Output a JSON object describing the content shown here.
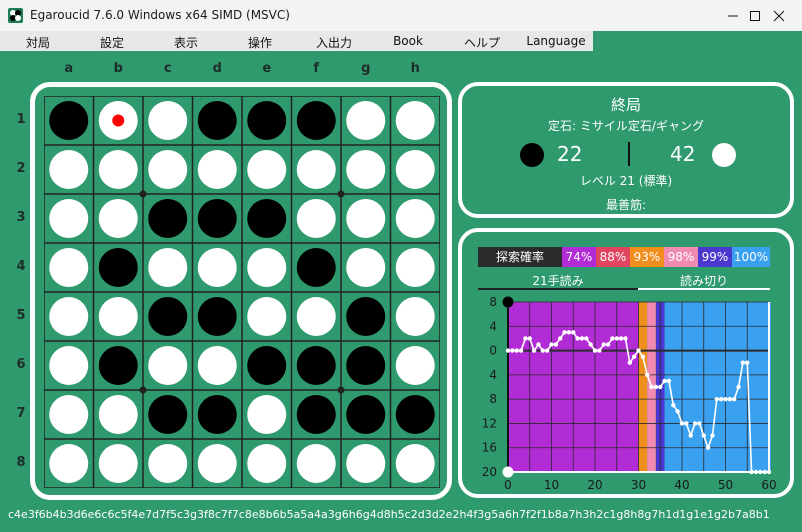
{
  "window": {
    "title": "Egaroucid 7.6.0 Windows x64 SIMD (MSVC)",
    "icon": "othello-app-icon",
    "controls": [
      "minimize-icon",
      "maximize-icon",
      "close-icon"
    ]
  },
  "menu": [
    "対局",
    "設定",
    "表示",
    "操作",
    "入出力",
    "Book",
    "ヘルプ",
    "Language"
  ],
  "board": {
    "columns": [
      "a",
      "b",
      "c",
      "d",
      "e",
      "f",
      "g",
      "h"
    ],
    "rows": [
      "1",
      "2",
      "3",
      "4",
      "5",
      "6",
      "7",
      "8"
    ],
    "cells": [
      "BWWBBBWW",
      "WWWWWWWW",
      "WWBBBWWW",
      "WBWWWBWW",
      "WWBBWWBW",
      "WBWWBBBW",
      "WWBBWBBB",
      "WWWWWWWW"
    ],
    "last_move": "b1",
    "colors": {
      "green": "#2e9a6e",
      "line": "#222222",
      "marker": "#ff0000"
    }
  },
  "info": {
    "status": "終局",
    "opening": "定石: ミサイル定石/ギャング",
    "black_score": "22",
    "white_score": "42",
    "level": "レベル 21 (標準)",
    "best_line": "最善筋:"
  },
  "legend": {
    "title": "探索確率",
    "items": [
      {
        "label": "74%",
        "color": "#b22cd6"
      },
      {
        "label": "88%",
        "color": "#e0445e"
      },
      {
        "label": "93%",
        "color": "#f08e1e"
      },
      {
        "label": "98%",
        "color": "#f08ab0"
      },
      {
        "label": "99%",
        "color": "#4b38d0"
      },
      {
        "label": "100%",
        "color": "#3aa0f0"
      }
    ]
  },
  "modes": {
    "midgame": "21手読み",
    "endgame": "読み切り"
  },
  "chart_data": {
    "type": "line",
    "xlim": [
      0,
      60
    ],
    "ylim": [
      20,
      -8
    ],
    "x_ticks": [
      "0",
      "10",
      "20",
      "30",
      "40",
      "50",
      "60"
    ],
    "y_ticks": [
      "8",
      "4",
      "0",
      "4",
      "8",
      "12",
      "16",
      "20"
    ],
    "y_tick_values": [
      -8,
      -4,
      0,
      4,
      8,
      12,
      16,
      20
    ],
    "bands": [
      {
        "from": 0,
        "to": 30,
        "color": "#b22cd6"
      },
      {
        "from": 30,
        "to": 32,
        "color": "#f08e1e"
      },
      {
        "from": 32,
        "to": 34,
        "color": "#f08ab0"
      },
      {
        "from": 34,
        "to": 36,
        "color": "#4b38d0"
      },
      {
        "from": 36,
        "to": 61,
        "color": "#3aa0f0"
      }
    ],
    "series": [
      {
        "x": [
          0,
          1,
          2,
          3,
          4,
          5,
          6,
          7,
          8,
          9,
          10,
          11,
          12,
          13,
          14,
          15,
          16,
          17,
          18,
          19,
          20,
          21,
          22,
          23,
          24,
          25,
          26,
          27,
          28,
          29,
          30,
          31,
          32,
          33,
          34,
          35,
          36,
          37,
          38,
          39,
          40,
          41,
          42,
          43,
          44,
          45,
          46,
          47,
          48,
          49,
          50,
          51,
          52,
          53,
          54,
          55,
          56,
          57,
          58,
          59,
          60
        ],
        "y": [
          0,
          0,
          0,
          0,
          -2,
          -2,
          0,
          -1,
          0,
          0,
          -1,
          -1,
          -2,
          -3,
          -3,
          -3,
          -2,
          -2,
          -2,
          -1,
          0,
          0,
          -1,
          -1,
          -2,
          -2,
          -2,
          -2,
          2,
          1,
          0,
          1,
          4,
          6,
          6,
          6,
          5,
          5,
          9,
          10,
          12,
          12,
          14,
          12,
          12,
          14,
          16,
          14,
          8,
          8,
          8,
          8,
          8,
          6,
          2,
          2,
          20,
          20,
          20,
          20,
          20
        ]
      }
    ],
    "start_disc_black_y": -8,
    "start_disc_white_y": 20
  },
  "transcript": "c4e3f6b4b3d6e6c6c5f4e7d7f5c3g3f8c7f7c8e8b6b5a5a4a3g6h6g4d8h5c2d3d2e2h4f3g5a6h7f2f1b8a7h3h2c1g8h8g7h1d1g1e1g2b7a8b1"
}
